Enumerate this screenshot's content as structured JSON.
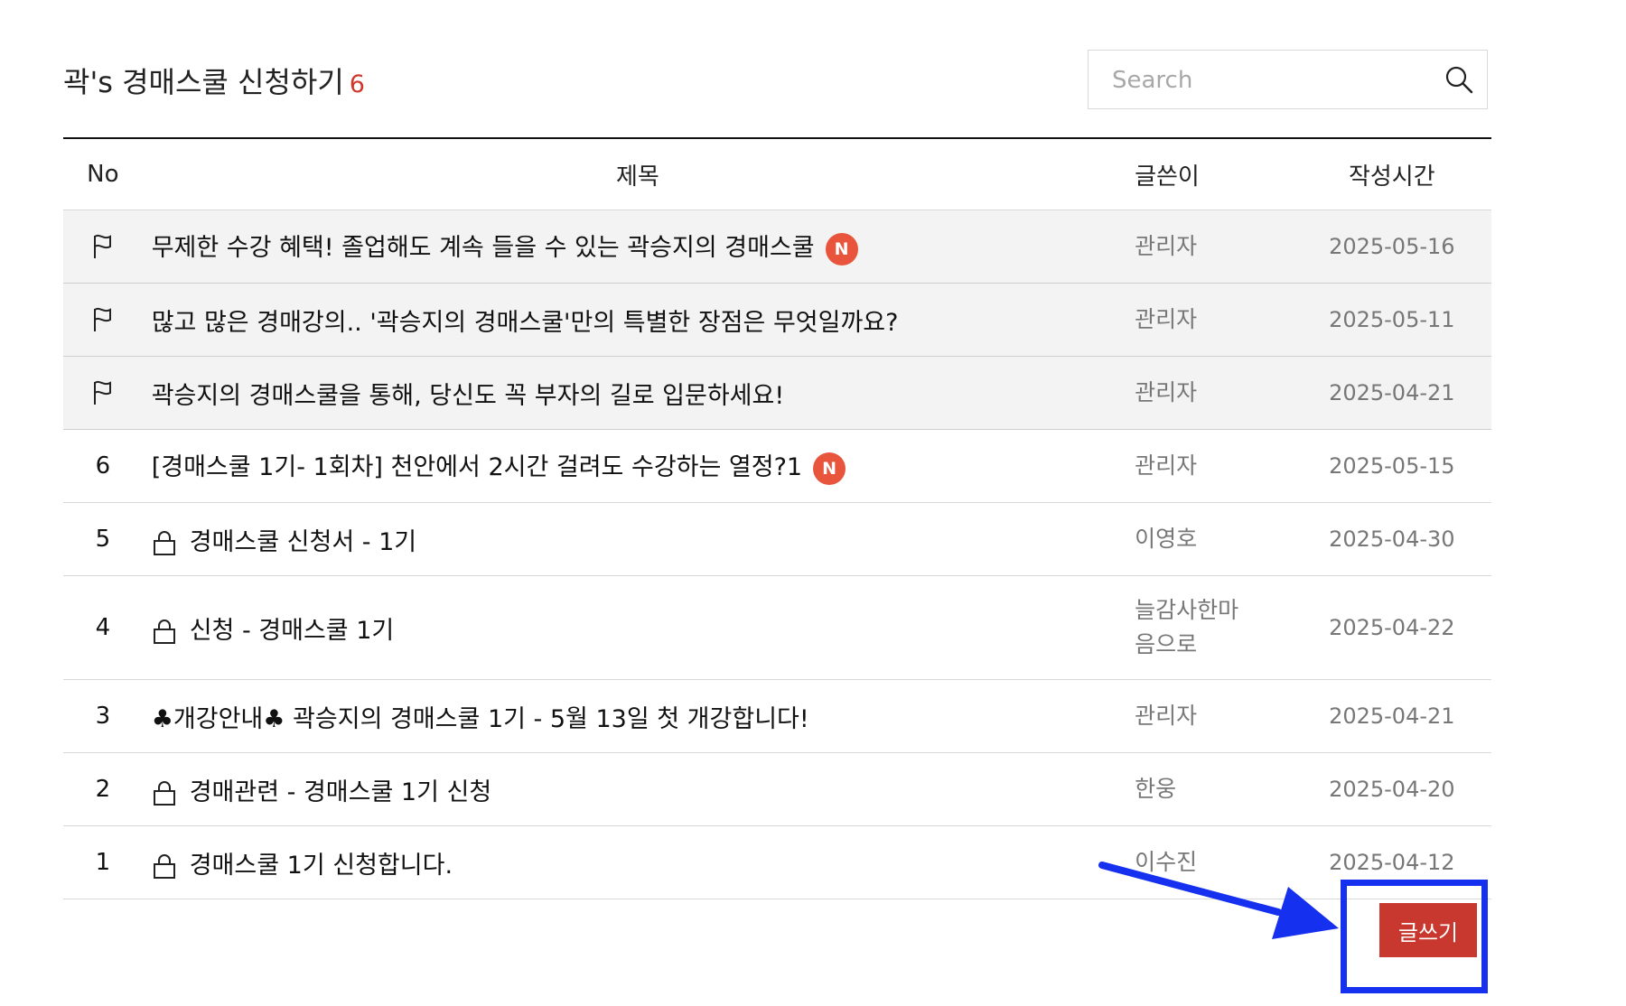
{
  "header": {
    "title": "곽's 경매스쿨 신청하기",
    "count": "6"
  },
  "search": {
    "placeholder": "Search"
  },
  "table": {
    "columns": {
      "no": "No",
      "subject": "제목",
      "author": "글쓴이",
      "date": "작성시간"
    },
    "notices": [
      {
        "subject": "무제한 수강 혜택! 졸업해도 계속 들을 수 있는 곽승지의 경매스쿨",
        "badge": "N",
        "author": "관리자",
        "date": "2025-05-16"
      },
      {
        "subject": "많고 많은 경매강의.. '곽승지의 경매스쿨'만의 특별한 장점은 무엇일까요?",
        "author": "관리자",
        "date": "2025-05-11"
      },
      {
        "subject": "곽승지의 경매스쿨을 통해, 당신도 꼭 부자의 길로 입문하세요!",
        "author": "관리자",
        "date": "2025-04-21"
      }
    ],
    "rows": [
      {
        "no": "6",
        "subject": "[경매스쿨 1기- 1회차] 천안에서 2시간 걸려도 수강하는 열정?1",
        "badge": "N",
        "locked": false,
        "author": "관리자",
        "date": "2025-05-15"
      },
      {
        "no": "5",
        "subject": "경매스쿨 신청서 - 1기",
        "locked": true,
        "author": "이영호",
        "date": "2025-04-30"
      },
      {
        "no": "4",
        "subject": "신청 - 경매스쿨 1기",
        "locked": true,
        "author_line1": "늘감사한마",
        "author_line2": "음으로",
        "date": "2025-04-22"
      },
      {
        "no": "3",
        "subject": "♣개강안내♣ 곽승지의 경매스쿨 1기 - 5월 13일 첫 개강합니다!",
        "locked": false,
        "author": "관리자",
        "date": "2025-04-21"
      },
      {
        "no": "2",
        "subject": "경매관련 - 경매스쿨 1기 신청",
        "locked": true,
        "author": "한웅",
        "date": "2025-04-20"
      },
      {
        "no": "1",
        "subject": "경매스쿨 1기 신청합니다.",
        "locked": true,
        "author": "이수진",
        "date": "2025-04-12"
      }
    ]
  },
  "actions": {
    "write_label": "글쓰기"
  },
  "icons": {
    "search": "search-icon",
    "notice": "flag-icon",
    "private": "lock-icon"
  },
  "colors": {
    "accent": "#c8382f",
    "badge": "#e8543c",
    "highlight": "#1530ee"
  }
}
